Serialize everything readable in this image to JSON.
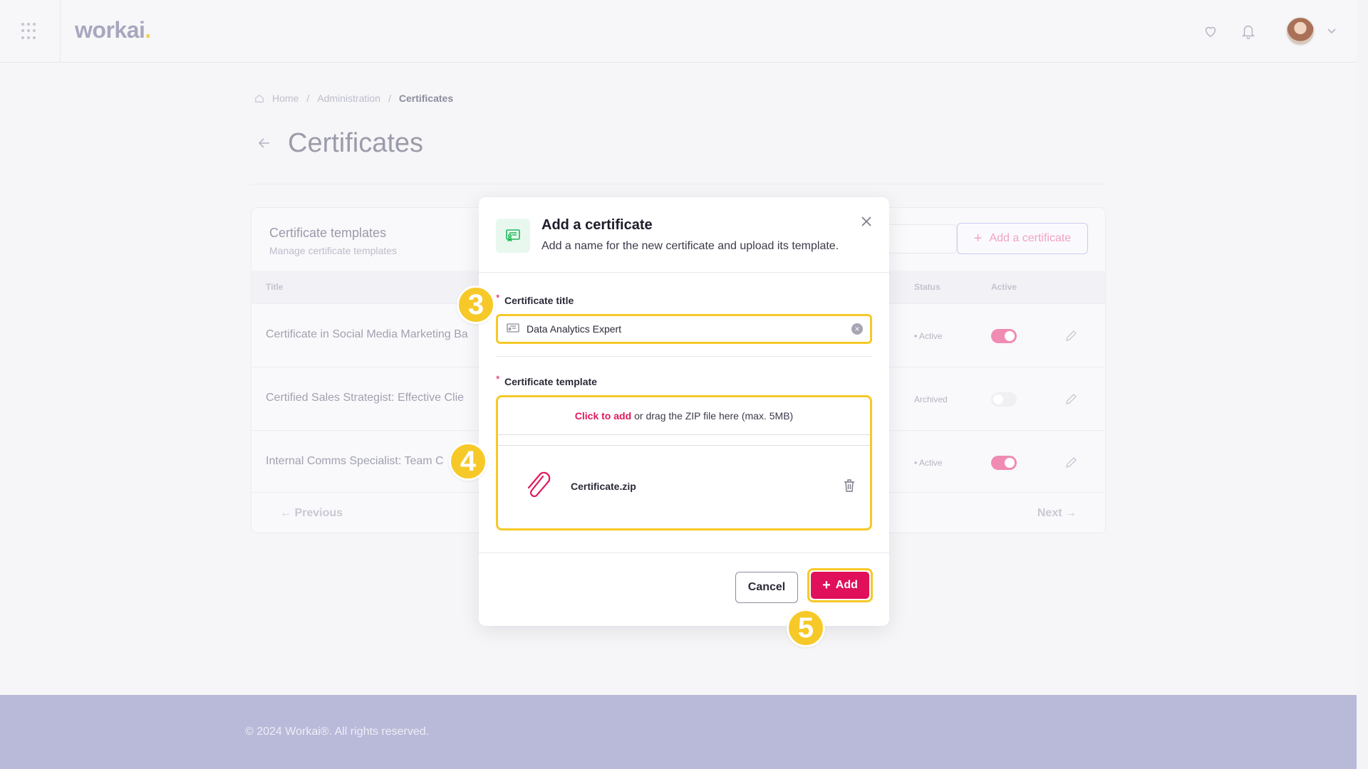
{
  "app": {
    "logo": "workai",
    "logo_dot": "."
  },
  "breadcrumb": {
    "home": "Home",
    "admin": "Administration",
    "current": "Certificates"
  },
  "page": {
    "title": "Certificates"
  },
  "card": {
    "title": "Certificate templates",
    "subtitle": "Manage certificate templates",
    "add_button": "Add a certificate",
    "columns": {
      "title": "Title",
      "status": "Status",
      "active": "Active"
    },
    "rows": [
      {
        "title": "Certificate in Social Media Marketing Ba",
        "status": "• Active",
        "active": true
      },
      {
        "title": "Certified Sales Strategist: Effective Clie",
        "status": "Archived",
        "active": false
      },
      {
        "title": "Internal Comms Specialist: Team C",
        "status": "• Active",
        "active": true
      }
    ],
    "pager": {
      "previous": "Previous",
      "next": "Next"
    }
  },
  "modal": {
    "title": "Add a certificate",
    "subtitle": "Add a name for the new certificate and upload its template.",
    "req_mark": "*",
    "title_field": {
      "label": "Certificate title",
      "value": "Data Analytics Expert"
    },
    "template_field": {
      "label": "Certificate template",
      "drop_link": "Click to add",
      "drop_text": "or drag the ZIP file here (max. 5MB)",
      "file_name": "Certificate.zip"
    },
    "cancel": "Cancel",
    "add": "Add"
  },
  "steps": {
    "s3": "3",
    "s4": "4",
    "s5": "5"
  },
  "footer": {
    "text": "© 2024 Workai®. All rights reserved."
  },
  "colors": {
    "accent": "#e0105a",
    "highlight": "#f6c928",
    "icon_green": "#1fb75a"
  }
}
